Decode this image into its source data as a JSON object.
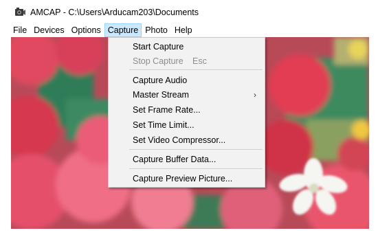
{
  "window": {
    "title": "AMCAP - C:\\Users\\Arducam203\\Documents",
    "icon": "camera-app-icon"
  },
  "menubar": {
    "items": [
      {
        "label": "File"
      },
      {
        "label": "Devices"
      },
      {
        "label": "Options"
      },
      {
        "label": "Capture",
        "active": true
      },
      {
        "label": "Photo"
      },
      {
        "label": "Help"
      }
    ]
  },
  "capture_menu": {
    "items": [
      {
        "label": "Start Capture"
      },
      {
        "label": "Stop Capture",
        "shortcut": "Esc",
        "disabled": true
      },
      {
        "label": "Capture Audio"
      },
      {
        "label": "Master Stream",
        "submenu_arrow": "›"
      },
      {
        "label": "Set Frame Rate..."
      },
      {
        "label": "Set Time Limit..."
      },
      {
        "label": "Set Video Compressor..."
      },
      {
        "label": "Capture Buffer Data..."
      },
      {
        "label": "Capture Preview Picture..."
      }
    ]
  },
  "colors": {
    "menu_highlight": "#cce8ff",
    "menu_highlight_border": "#99d1ff",
    "dropdown_bg": "#f2f2f2",
    "disabled_text": "#8d8d8d"
  }
}
